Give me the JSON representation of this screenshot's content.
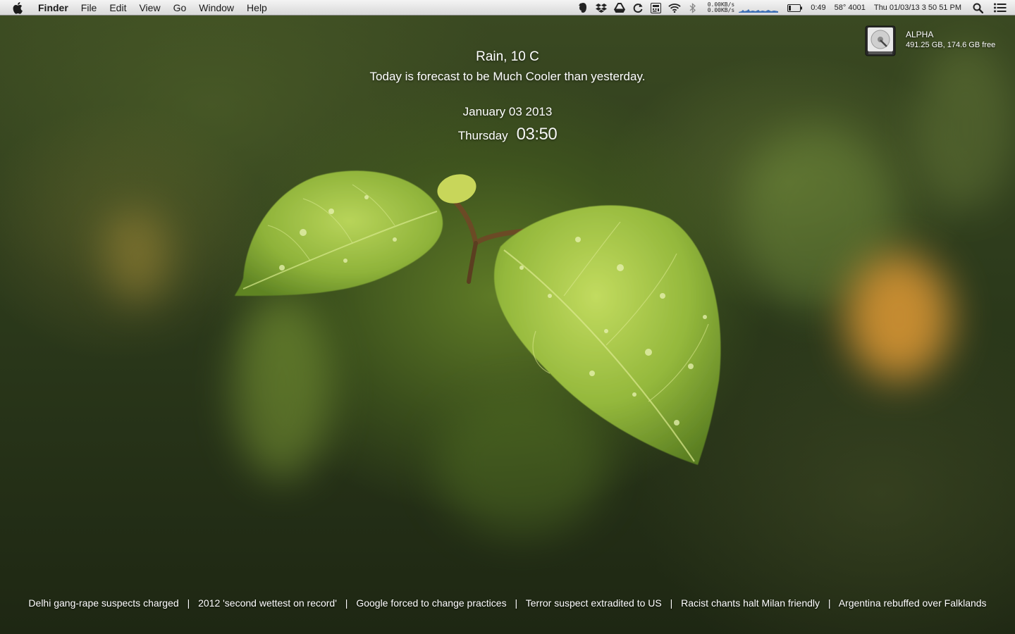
{
  "menubar": {
    "app_name": "Finder",
    "menus": [
      "File",
      "Edit",
      "View",
      "Go",
      "Window",
      "Help"
    ],
    "status": {
      "net_up": "0.00KB/s",
      "net_down": "0.00KB/s",
      "battery_time": "0:49",
      "temperature": "58° 4001",
      "clock": "Thu 01/03/13 3 50 51 PM"
    },
    "icons": [
      "apple-icon",
      "evernote-icon",
      "dropbox-icon",
      "google-drive-icon",
      "sync-icon",
      "calculator-icon",
      "wifi-icon",
      "bluetooth-icon",
      "network-activity-icon",
      "battery-icon",
      "spotlight-icon",
      "notification-center-icon"
    ]
  },
  "desktop": {
    "drive": {
      "name": "ALPHA",
      "size": "491.25 GB, 174.6 GB free"
    }
  },
  "widget": {
    "condition": "Rain, 10 C",
    "forecast": "Today is forecast to be Much Cooler than yesterday.",
    "date": "January 03 2013",
    "weekday": "Thursday",
    "time": "03:50"
  },
  "news": {
    "separator": "|",
    "headlines": [
      "Delhi gang-rape suspects charged",
      "2012 'second wettest on record'",
      "Google forced to change practices",
      "Terror suspect extradited to US",
      "Racist chants halt Milan friendly",
      "Argentina rebuffed over Falklands"
    ]
  },
  "colors": {
    "menubar_bg": "#e6e6e6",
    "wallpaper_green": "#5e7a26",
    "bokeh_orange": "#e09a35",
    "widget_text": "#ffffff"
  }
}
